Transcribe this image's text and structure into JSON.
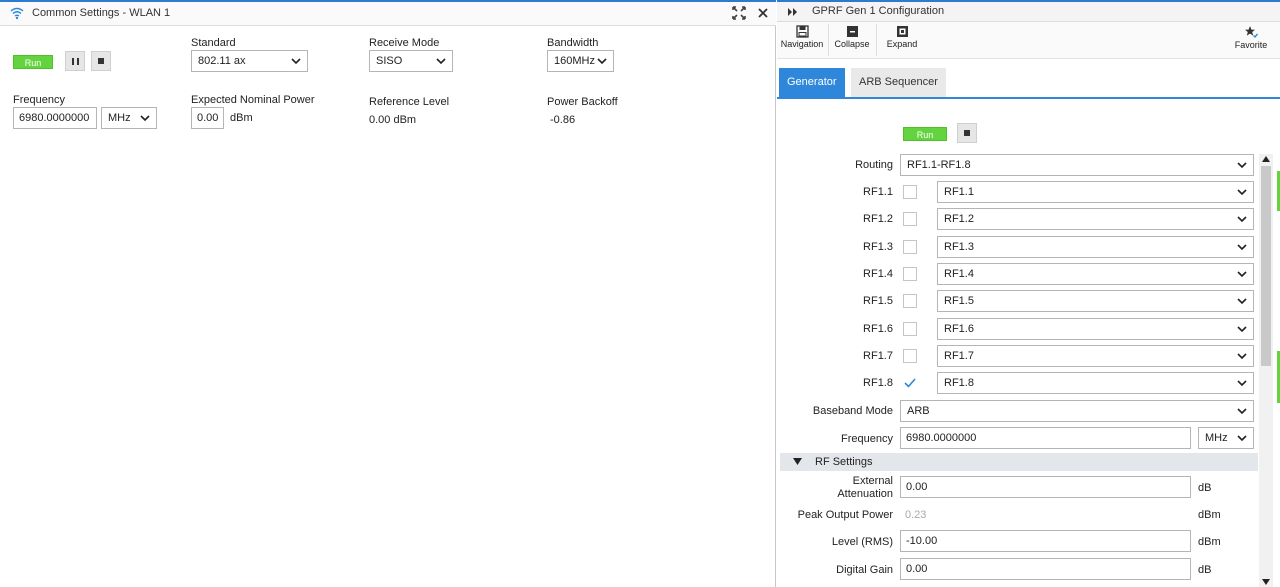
{
  "left": {
    "title": "Common Settings - WLAN 1",
    "controls": {
      "run_label": "Run"
    },
    "standard": {
      "label": "Standard",
      "value": "802.11 ax"
    },
    "receive_mode": {
      "label": "Receive Mode",
      "value": "SISO"
    },
    "bandwidth": {
      "label": "Bandwidth",
      "value": "160MHz"
    },
    "frequency": {
      "label": "Frequency",
      "value": "6980.0000000",
      "unit": "MHz"
    },
    "expected_power": {
      "label": "Expected Nominal Power",
      "value": "0.00",
      "unit": "dBm"
    },
    "reference_level": {
      "label": "Reference Level",
      "value": "0.00 dBm"
    },
    "power_backoff": {
      "label": "Power Backoff",
      "value": "-0.86"
    }
  },
  "right": {
    "title": "GPRF Gen 1 Configuration",
    "toolbar": {
      "navigation": "Navigation",
      "collapse": "Collapse",
      "expand": "Expand",
      "favorite": "Favorite"
    },
    "tabs": [
      {
        "label": "Generator",
        "active": true
      },
      {
        "label": "ARB Sequencer",
        "active": false
      }
    ],
    "run_label": "Run",
    "routing": {
      "label": "Routing",
      "value": "RF1.1-RF1.8"
    },
    "rf_ports": [
      {
        "label": "RF1.1",
        "value": "RF1.1",
        "checked": false
      },
      {
        "label": "RF1.2",
        "value": "RF1.2",
        "checked": false
      },
      {
        "label": "RF1.3",
        "value": "RF1.3",
        "checked": false
      },
      {
        "label": "RF1.4",
        "value": "RF1.4",
        "checked": false
      },
      {
        "label": "RF1.5",
        "value": "RF1.5",
        "checked": false
      },
      {
        "label": "RF1.6",
        "value": "RF1.6",
        "checked": false
      },
      {
        "label": "RF1.7",
        "value": "RF1.7",
        "checked": false
      },
      {
        "label": "RF1.8",
        "value": "RF1.8",
        "checked": true
      }
    ],
    "baseband_mode": {
      "label": "Baseband Mode",
      "value": "ARB"
    },
    "frequency": {
      "label": "Frequency",
      "value": "6980.0000000",
      "unit": "MHz"
    },
    "rf_settings": {
      "section_label": "RF Settings",
      "external_attenuation": {
        "label_line1": "External",
        "label_line2": "Attenuation",
        "value": "0.00",
        "unit": "dB"
      },
      "peak_output_power": {
        "label": "Peak Output Power",
        "value": "0.23",
        "unit": "dBm"
      },
      "level_rms": {
        "label": "Level (RMS)",
        "value": "-10.00",
        "unit": "dBm"
      },
      "digital_gain": {
        "label": "Digital Gain",
        "value": "0.00",
        "unit": "dB"
      }
    }
  },
  "colors": {
    "accent_blue": "#2e87da",
    "run_green": "#63d33f",
    "section_gray": "#e3e6ea"
  }
}
